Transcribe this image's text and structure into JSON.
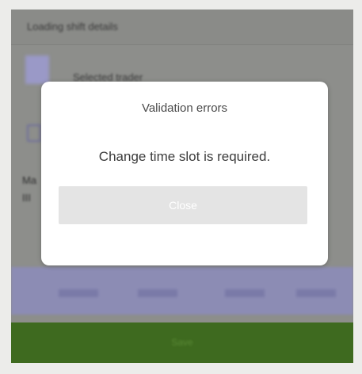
{
  "background_screen": {
    "header_label": "Loading shift details",
    "row_label": "Selected trader",
    "side_text": [
      "Ma",
      "III"
    ],
    "bottom_bar_label": "Save",
    "bottom_bar_color": "#3e6a1f"
  },
  "modal": {
    "title": "Validation errors",
    "message": "Change time slot is required.",
    "button_label": "Close"
  }
}
